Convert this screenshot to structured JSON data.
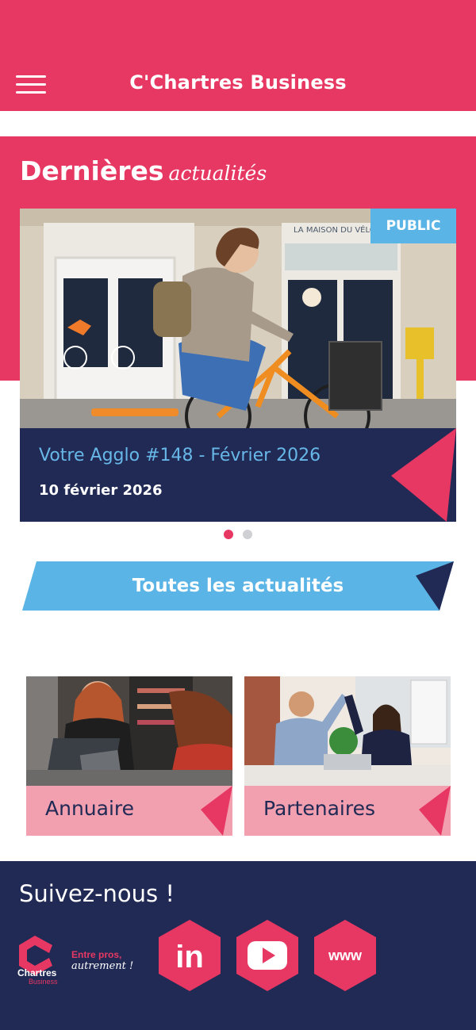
{
  "header": {
    "title": "C'Chartres Business"
  },
  "news": {
    "heading": "Dernières",
    "heading_script": "actualités",
    "card": {
      "badge": "PUBLIC",
      "title": "Votre Agglo #148 - Février 2026",
      "date": "10 février 2026",
      "storefront_sign": "LA MAISON DU VÉLO"
    },
    "carousel": {
      "total": 2,
      "active": 1
    },
    "all_button": "Toutes les actualités"
  },
  "tiles": [
    {
      "label": "Annuaire"
    },
    {
      "label": "Partenaires"
    }
  ],
  "footer": {
    "follow_label": "Suivez-nous !",
    "logo": {
      "name_top": "Chartres",
      "name_bottom": "Business",
      "tagline_1": "Entre pros,",
      "tagline_2": "autrement !"
    },
    "social": [
      {
        "icon": "linkedin-icon",
        "text": "in"
      },
      {
        "icon": "youtube-icon",
        "text": ""
      },
      {
        "icon": "website-icon",
        "text": "www"
      }
    ]
  },
  "colors": {
    "brand_pink": "#e73863",
    "navy": "#212a55",
    "sky_blue": "#5ab4e6",
    "light_pink": "#f2a0b0"
  }
}
